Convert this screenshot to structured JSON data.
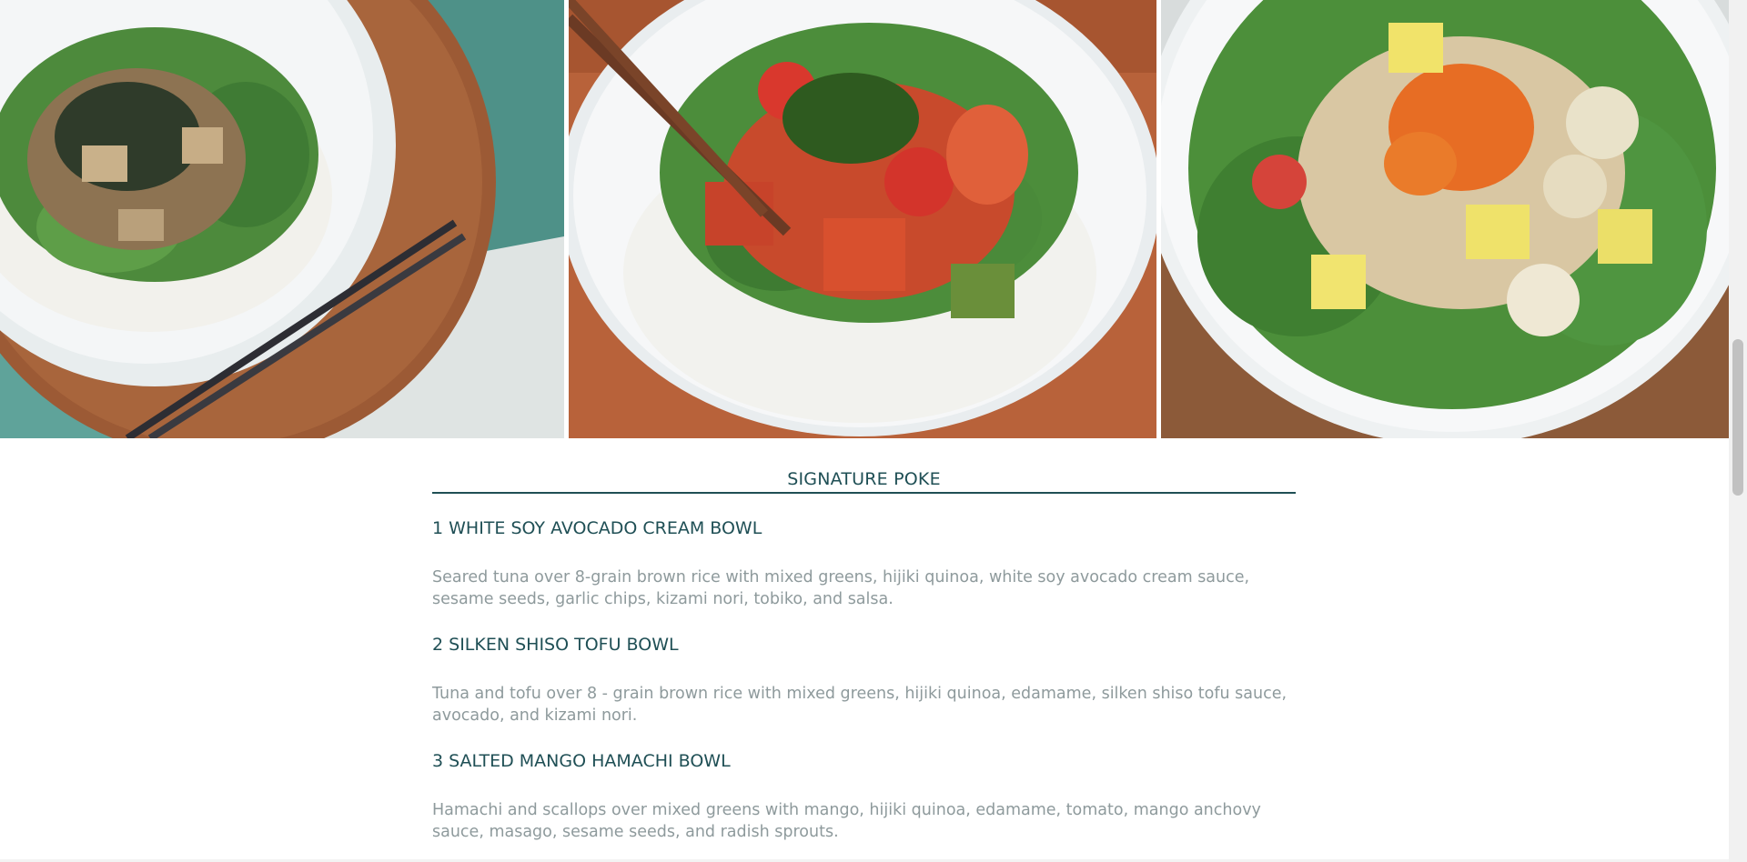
{
  "photos": [
    {
      "name": "tofu-poke-bowl-photo"
    },
    {
      "name": "spicy-tuna-poke-bowl-photo"
    },
    {
      "name": "scallop-mango-poke-bowl-photo"
    }
  ],
  "menu": {
    "heading": "SIGNATURE POKE",
    "items": [
      {
        "title": "1 WHITE SOY AVOCADO CREAM BOWL",
        "description": "Seared tuna over 8-grain brown rice with mixed greens, hijiki quinoa, white soy avocado cream sauce, sesame seeds, garlic chips, kizami nori, tobiko, and salsa."
      },
      {
        "title": "2 SILKEN SHISO TOFU BOWL",
        "description": "Tuna and tofu over 8 - grain brown rice with mixed greens, hijiki quinoa, edamame, silken shiso tofu sauce, avocado, and kizami nori."
      },
      {
        "title": "3 SALTED MANGO HAMACHI BOWL",
        "description": "Hamachi and scallops over mixed greens with mango, hijiki quinoa, edamame, tomato, mango anchovy sauce, masago, sesame seeds, and radish sprouts."
      }
    ]
  },
  "colors": {
    "heading": "#1f4f55",
    "description": "#8e9a9c"
  }
}
